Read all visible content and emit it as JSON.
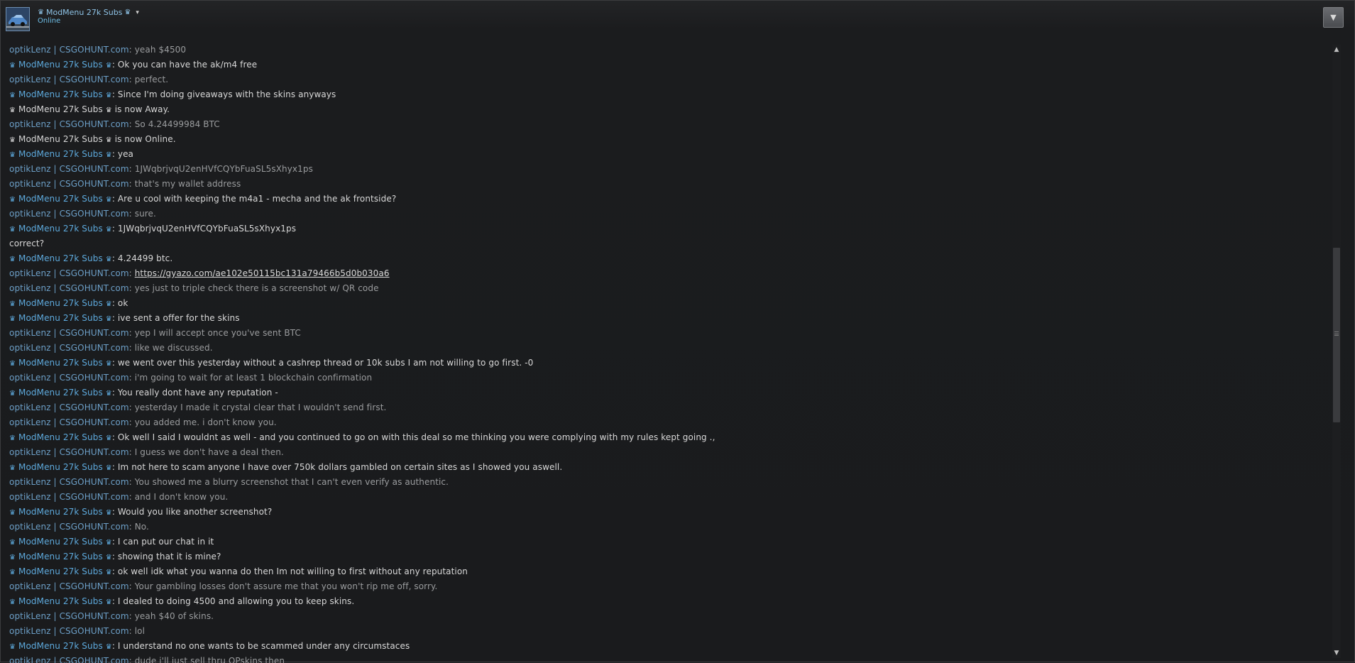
{
  "header": {
    "crown_left": "♛",
    "friend_name": "ModMenu 27k Subs",
    "crown_right": "♛",
    "dropdown_caret": "▾",
    "status": "Online",
    "menu_caret": "▼"
  },
  "participants": {
    "them": "optikLenz | CSGOHUNT.com",
    "me": "ModMenu 27k Subs"
  },
  "messages": [
    {
      "kind": "them",
      "sender": "optikLenz | CSGOHUNT.com",
      "text": "yeah $4500"
    },
    {
      "kind": "me",
      "sender": "ModMenu 27k Subs",
      "text": "Ok you can have the ak/m4 free"
    },
    {
      "kind": "them",
      "sender": "optikLenz | CSGOHUNT.com",
      "text": "perfect."
    },
    {
      "kind": "me",
      "sender": "ModMenu 27k Subs",
      "text": "Since I'm doing giveaways with the skins anyways"
    },
    {
      "kind": "status",
      "sender": "ModMenu 27k Subs",
      "text": "is now Away."
    },
    {
      "kind": "them",
      "sender": "optikLenz | CSGOHUNT.com",
      "text": "So 4.24499984 BTC"
    },
    {
      "kind": "status",
      "sender": "ModMenu 27k Subs",
      "text": "is now Online."
    },
    {
      "kind": "me",
      "sender": "ModMenu 27k Subs",
      "text": "yea"
    },
    {
      "kind": "them",
      "sender": "optikLenz | CSGOHUNT.com",
      "text": "1JWqbrjvqU2enHVfCQYbFuaSL5sXhyx1ps"
    },
    {
      "kind": "them",
      "sender": "optikLenz | CSGOHUNT.com",
      "text": "that's my wallet address"
    },
    {
      "kind": "me",
      "sender": "ModMenu 27k Subs",
      "text": "Are u cool with keeping the m4a1 - mecha and the ak frontside?"
    },
    {
      "kind": "them",
      "sender": "optikLenz | CSGOHUNT.com",
      "text": "sure."
    },
    {
      "kind": "me",
      "sender": "ModMenu 27k Subs",
      "text": "1JWqbrjvqU2enHVfCQYbFuaSL5sXhyx1ps"
    },
    {
      "kind": "continuation",
      "text": " correct?"
    },
    {
      "kind": "me",
      "sender": "ModMenu 27k Subs",
      "text": "4.24499 btc."
    },
    {
      "kind": "them-link",
      "sender": "optikLenz | CSGOHUNT.com",
      "text": "https://gyazo.com/ae102e50115bc131a79466b5d0b030a6"
    },
    {
      "kind": "them",
      "sender": "optikLenz | CSGOHUNT.com",
      "text": "yes just to triple check there is a screenshot w/ QR code"
    },
    {
      "kind": "me",
      "sender": "ModMenu 27k Subs",
      "text": "ok"
    },
    {
      "kind": "me",
      "sender": "ModMenu 27k Subs",
      "text": "ive sent a offer for the skins"
    },
    {
      "kind": "them",
      "sender": "optikLenz | CSGOHUNT.com",
      "text": "yep I will accept once you've sent BTC"
    },
    {
      "kind": "them",
      "sender": "optikLenz | CSGOHUNT.com",
      "text": "like we discussed."
    },
    {
      "kind": "me",
      "sender": "ModMenu 27k Subs",
      "text": "we went over this yesterday without a cashrep thread or 10k subs I am not willing to go first. -0"
    },
    {
      "kind": "them",
      "sender": "optikLenz | CSGOHUNT.com",
      "text": "i'm going to wait for at least 1 blockchain confirmation"
    },
    {
      "kind": "me",
      "sender": "ModMenu 27k Subs",
      "text": "You really dont have any reputation -"
    },
    {
      "kind": "them",
      "sender": "optikLenz | CSGOHUNT.com",
      "text": "yesterday I made it crystal clear that I wouldn't send first."
    },
    {
      "kind": "them",
      "sender": "optikLenz | CSGOHUNT.com",
      "text": "you added me. i don't know you."
    },
    {
      "kind": "me",
      "sender": "ModMenu 27k Subs",
      "text": "Ok well I said I wouldnt as well - and you continued to go on with this deal so me thinking you were complying with my rules kept going .,"
    },
    {
      "kind": "them",
      "sender": "optikLenz | CSGOHUNT.com",
      "text": "I guess we don't have a deal then."
    },
    {
      "kind": "me",
      "sender": "ModMenu 27k Subs",
      "text": "Im not here to scam anyone I have over 750k dollars gambled on certain sites as I showed you aswell."
    },
    {
      "kind": "them",
      "sender": "optikLenz | CSGOHUNT.com",
      "text": "You showed me a blurry screenshot that I can't even verify as authentic."
    },
    {
      "kind": "them",
      "sender": "optikLenz | CSGOHUNT.com",
      "text": "and I don't know you."
    },
    {
      "kind": "me",
      "sender": "ModMenu 27k Subs",
      "text": "Would you like another screenshot?"
    },
    {
      "kind": "them",
      "sender": "optikLenz | CSGOHUNT.com",
      "text": "No."
    },
    {
      "kind": "me",
      "sender": "ModMenu 27k Subs",
      "text": "I can put our chat in it"
    },
    {
      "kind": "me",
      "sender": "ModMenu 27k Subs",
      "text": "showing that it is mine?"
    },
    {
      "kind": "me",
      "sender": "ModMenu 27k Subs",
      "text": "ok well idk what you wanna do then Im not willing to first without any reputation"
    },
    {
      "kind": "them",
      "sender": "optikLenz | CSGOHUNT.com",
      "text": "Your gambling losses don't assure me that you won't rip me off, sorry."
    },
    {
      "kind": "me",
      "sender": "ModMenu 27k Subs",
      "text": "I dealed to doing 4500 and allowing you to keep skins."
    },
    {
      "kind": "them",
      "sender": "optikLenz | CSGOHUNT.com",
      "text": "yeah $40 of skins."
    },
    {
      "kind": "them",
      "sender": "optikLenz | CSGOHUNT.com",
      "text": "lol"
    },
    {
      "kind": "me",
      "sender": "ModMenu 27k Subs",
      "text": "I understand no one wants to be scammed under any circumstaces"
    },
    {
      "kind": "them",
      "sender": "optikLenz | CSGOHUNT.com",
      "text": "dude i'll just sell thru OPskins then"
    }
  ],
  "scrollbar": {
    "up": "▲",
    "down": "▼",
    "grip": "≡"
  },
  "colors": {
    "them_name": "#6c9fc7",
    "me_name": "#5da9dc",
    "them_text": "#9a9c9e",
    "me_text": "#d8d8d8",
    "background": "#1c1d1f"
  }
}
